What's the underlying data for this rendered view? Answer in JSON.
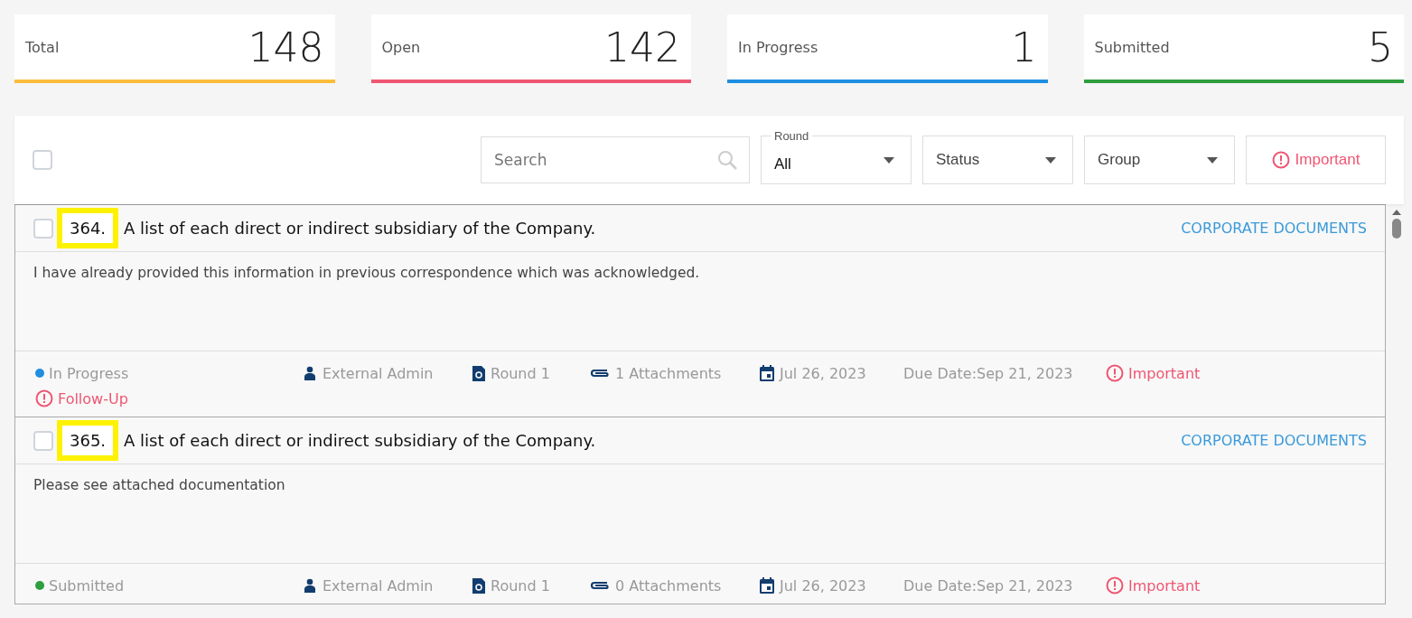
{
  "stats": [
    {
      "label": "Total",
      "value": "148",
      "color": "#fbbd3c"
    },
    {
      "label": "Open",
      "value": "142",
      "color": "#ef5672"
    },
    {
      "label": "In Progress",
      "value": "1",
      "color": "#1e8fe1"
    },
    {
      "label": "Submitted",
      "value": "5",
      "color": "#2e9e3e"
    }
  ],
  "toolbar": {
    "select_all_checked": false,
    "search": {
      "placeholder": "Search"
    },
    "filters": [
      {
        "label": "Round",
        "value": "All"
      },
      {
        "label": "Status"
      },
      {
        "label": "Group"
      }
    ],
    "important_button": "Important"
  },
  "items": [
    {
      "checked": false,
      "number": "364.",
      "number_highlighted": true,
      "title": "A list of each direct or indirect subsidiary of the Company.",
      "category": "CORPORATE DOCUMENTS",
      "response": "I have already provided this information in previous correspondence which was acknowledged.",
      "status": "In Progress",
      "color": "#1e8fe1",
      "owner": "External Admin",
      "round": "Round 1",
      "attachments": "1 Attachments",
      "date": "Jul 26, 2023",
      "due_date": "Due Date:Sep 21, 2023",
      "flags": [
        "Important",
        "Follow-Up"
      ]
    },
    {
      "checked": false,
      "number": "365.",
      "number_highlighted": true,
      "title": "A list of each direct or indirect subsidiary of the Company.",
      "category": "CORPORATE DOCUMENTS",
      "response": "Please see attached documentation",
      "status": "Submitted",
      "color": "#2e9e3e",
      "owner": "External Admin",
      "round": "Round 1",
      "attachments": "0 Attachments",
      "date": "Jul 26, 2023",
      "due_date": "Due Date:Sep 21, 2023",
      "flags": [
        "Important"
      ]
    }
  ]
}
